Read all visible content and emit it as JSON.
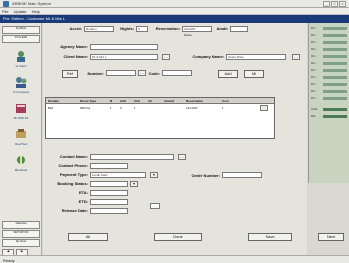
{
  "window": {
    "title": "ARBISE Main System"
  },
  "menu": [
    "File",
    "Update",
    "Help"
  ],
  "form_title": "Pro: Edition - Customer Mr & Mrs L",
  "sidebar": {
    "top_buttons": [
      "Zp Blok",
      "Prov.Edit"
    ],
    "nav": [
      "Vi Client",
      "Vi Company",
      "Mr Whit Ftr",
      "Rep/Tool",
      "Merchant"
    ],
    "bottom_buttons": [
      "DateSet",
      "SETUP/OK",
      "Zp New"
    ]
  },
  "form": {
    "row1": {
      "accent_label": "Accnt:",
      "accent_value": "Roudon",
      "nights_label": "Nights:",
      "nights_value": "3",
      "reservation_label": "Reservation:",
      "reservation_value": "12/12/97",
      "reservation_sub": "Rates",
      "amendt_label": "Amdt:",
      "amendt_value": ""
    },
    "agency_label": "Agency Name:",
    "agency_value": "",
    "client_label": "Client Name:",
    "client_value": "Mr & Mrs L",
    "company_label": "Company Name:",
    "company_value": "Grass Drive",
    "ref_row": {
      "left_label": "Ref",
      "number_label": "Number:",
      "number_value": "",
      "code_label": "Code:",
      "code_value": "",
      "add_label": "Add",
      "mi_label": "Mi"
    },
    "contact_label": "Contact Name:",
    "contact_value": "",
    "phone_label": "Contact Phone:",
    "phone_value": "",
    "payment_label": "Payment Type:",
    "payment_value": "Credit Card",
    "order_label": "Order Number:",
    "order_value": "",
    "booking_label": "Booking Status:",
    "booking_value": "",
    "eta_label": "ETA:",
    "eta_value": "",
    "etd_label": "ETD:",
    "etd_value": "",
    "release_label": "Release Date:",
    "release_value": ""
  },
  "grid": {
    "headers": [
      "Domain",
      "Room Type",
      "N",
      "Adlt",
      "Chd",
      "Inf",
      "Amend",
      "Reservation",
      "Cost"
    ],
    "rows": [
      [
        "Bkd",
        "DB/Vsd",
        "1",
        "3",
        "1",
        "",
        "",
        "12/12/97",
        "1"
      ]
    ]
  },
  "buttons": {
    "all": "All",
    "done": "Done",
    "save": "Save",
    "extra": "Next"
  },
  "right_panel": {
    "rows": [
      "Rm",
      "Rm",
      "Rm",
      "Rm",
      "Rm",
      "Rm",
      "Rm",
      "Rm",
      "Rm",
      "Rm",
      "Rm",
      "Total",
      "Bal"
    ]
  },
  "status": "Ready",
  "colors": {
    "titlebar": "#1a3a7a",
    "field": "#ffffff",
    "panel": "#c8d4c0"
  }
}
